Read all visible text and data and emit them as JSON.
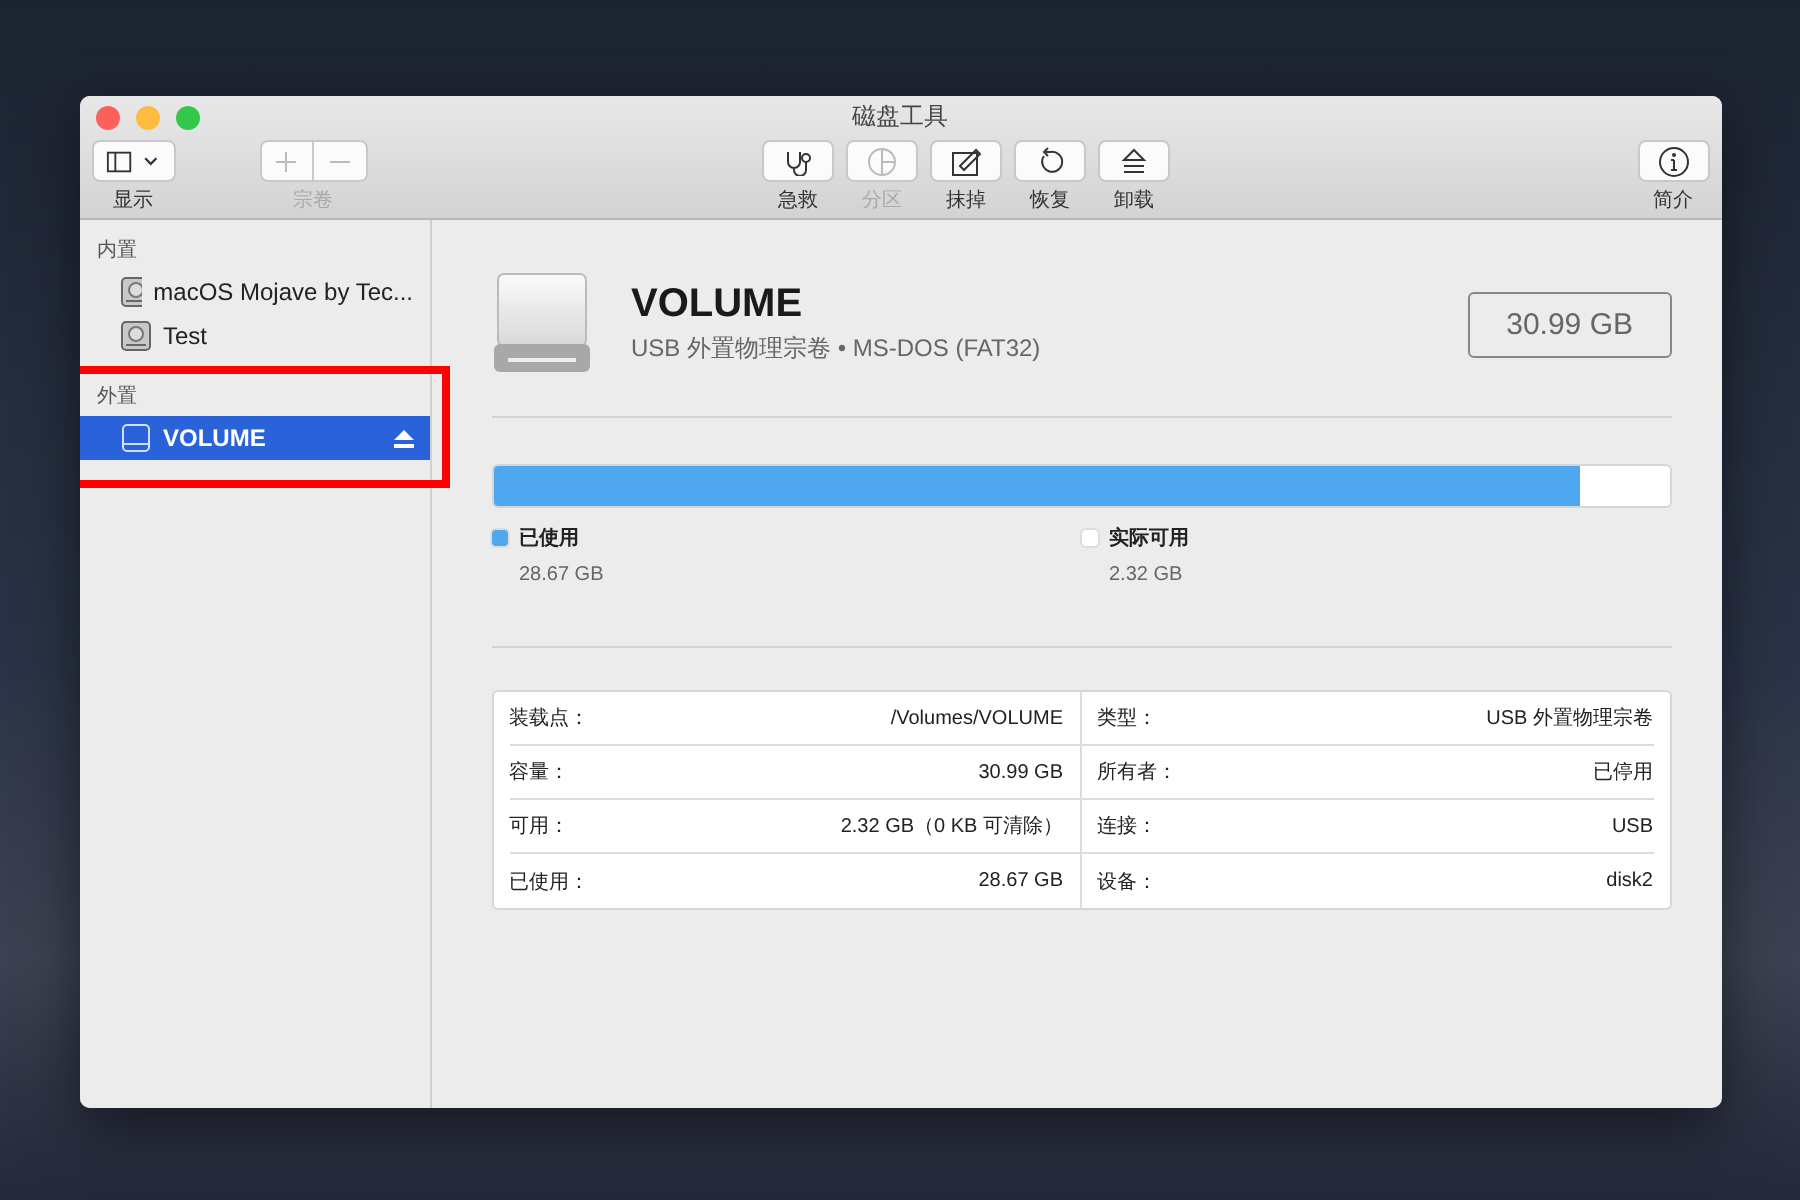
{
  "window": {
    "title": "磁盘工具"
  },
  "toolbar": {
    "left": [
      {
        "kind": "view",
        "label": "显示",
        "disabled": false
      },
      {
        "kind": "volume",
        "label": "宗卷",
        "disabled": true
      }
    ],
    "center": [
      {
        "kind": "firstaid",
        "label": "急救",
        "disabled": false
      },
      {
        "kind": "partition",
        "label": "分区",
        "disabled": true
      },
      {
        "kind": "erase",
        "label": "抹掉",
        "disabled": false
      },
      {
        "kind": "restore",
        "label": "恢复",
        "disabled": false
      },
      {
        "kind": "unmount",
        "label": "卸载",
        "disabled": false
      }
    ],
    "right": [
      {
        "kind": "info",
        "label": "简介",
        "disabled": false
      }
    ]
  },
  "sidebar": {
    "sections": [
      {
        "title": "内置",
        "highlighted": false,
        "items": [
          {
            "name": "macOS Mojave by Tec...",
            "kind": "internal",
            "selected": false,
            "eject": false
          },
          {
            "name": "Test",
            "kind": "internal",
            "selected": false,
            "eject": false
          }
        ]
      },
      {
        "title": "外置",
        "highlighted": true,
        "items": [
          {
            "name": "VOLUME",
            "kind": "external",
            "selected": true,
            "eject": true
          }
        ]
      }
    ]
  },
  "volume": {
    "name": "VOLUME",
    "subtitle": "USB 外置物理宗卷 • MS-DOS (FAT32)",
    "size": "30.99 GB"
  },
  "usage": {
    "level": 0.925,
    "legend": [
      {
        "label": "已使用",
        "value": "28.67 GB",
        "color": "#4fa7ef"
      },
      {
        "label": "实际可用",
        "value": "2.32 GB",
        "color": "#ffffff"
      }
    ]
  },
  "info": [
    {
      "label": "装载点：",
      "value": "/Volumes/VOLUME"
    },
    {
      "label": "容量：",
      "value": "30.99 GB"
    },
    {
      "label": "可用：",
      "value": "2.32 GB（0 KB 可清除）"
    },
    {
      "label": "已使用：",
      "value": "28.67 GB"
    },
    {
      "label": "类型：",
      "value": "USB 外置物理宗卷"
    },
    {
      "label": "所有者：",
      "value": "已停用"
    },
    {
      "label": "连接：",
      "value": "USB"
    },
    {
      "label": "设备：",
      "value": "disk2"
    }
  ]
}
